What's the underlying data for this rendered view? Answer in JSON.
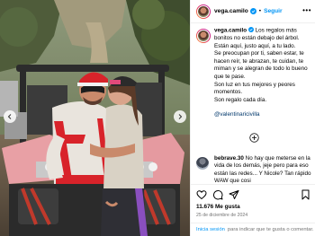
{
  "post": {
    "username": "vega.camilo",
    "follow_label": "Seguir",
    "separator": "•",
    "more_label": "•••",
    "caption": {
      "username": "vega.camilo",
      "lines": [
        "Los regalos más bonitos no están debajo del árbol. Están aquí, justo aquí, a tu lado.",
        "Se preocupan por ti, saben estar, te hacen reír, te abrazan, te cuidan, te miman y se alegran de todo lo bueno que te pase.",
        "Son luz en tus mejores y peores momentos.",
        "Son regalo cada día."
      ],
      "mention": "@valentinaricivilla"
    },
    "comment": {
      "username": "bebrave.30",
      "text": "No hay que meterse en la vida de los demás, jeje pero para eso están las redes...",
      "text2": "Y Nicole? Tan rápido WAW que cosi"
    },
    "likes": "11.676 Me gusta",
    "date": "25 de diciembre de 2024",
    "login_link": "Inicia sesión",
    "login_rest": "para indicar que te gusta o comentar."
  },
  "icons": {
    "prev": "chevron-left-icon",
    "next": "chevron-right-icon",
    "verified": "verified-badge-icon",
    "expand": "plus-circle-icon",
    "like": "heart-icon",
    "comment": "comment-icon",
    "share": "send-icon",
    "save": "bookmark-icon"
  },
  "colors": {
    "link": "#0095f6",
    "mention": "#00376b",
    "muted": "#737373",
    "honda_red": "#d8232a"
  }
}
